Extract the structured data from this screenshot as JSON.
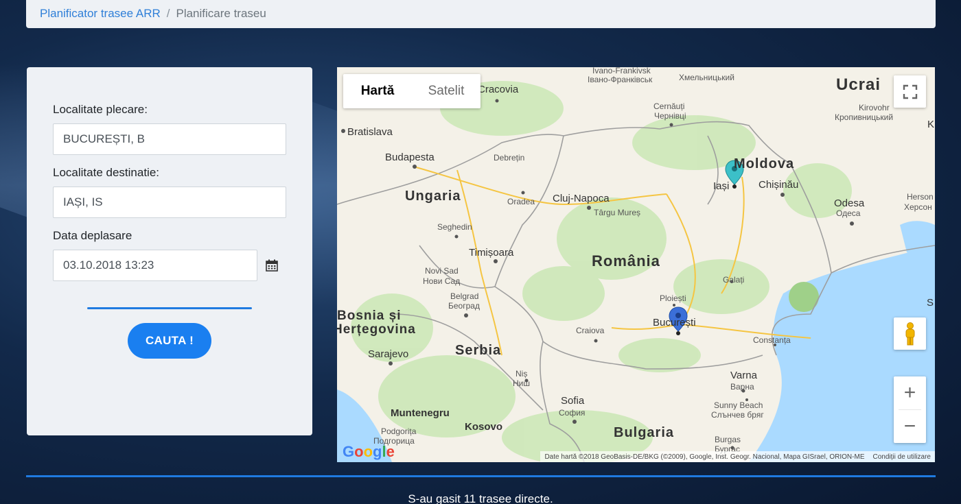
{
  "breadcrumb": {
    "parent": "Planificator trasee ARR",
    "separator": "/",
    "current": "Planificare traseu"
  },
  "form": {
    "departure_label": "Localitate plecare:",
    "departure_value": "BUCUREȘTI, B",
    "destination_label": "Localitate destinatie:",
    "destination_value": "IAȘI, IS",
    "date_label": "Data deplasare",
    "date_value": "03.10.2018 13:23",
    "calendar_icon": "calendar-icon",
    "search_button": "CAUTA !"
  },
  "map": {
    "tabs": {
      "map": "Hartă",
      "satellite": "Satelit"
    },
    "fullscreen_icon": "fullscreen-icon",
    "pegman_icon": "pegman-icon",
    "zoom_in": "+",
    "zoom_out": "−",
    "google_logo": "Google",
    "attribution": "Date hartă ©2018 GeoBasis-DE/BKG (©2009), Google, Inst. Geogr. Nacional, Mapa GISrael, ORION-ME",
    "terms": "Condiții de utilizare",
    "labels": {
      "ivano": "Ivano-Frankivsk",
      "ivano_cyr": "Івано-Франківськ",
      "khmel": "Хмельницький",
      "cracovia": "Cracovia",
      "ucraina": "Ucrai",
      "kirovohr": "Kirovohr",
      "kropyv": "Кропивницький",
      "cernauti": "Cernăuți",
      "cernauti_cyr": "Чернівці",
      "bratislava": "Bratislava",
      "budapesta": "Budapesta",
      "debretin": "Debrețin",
      "moldova": "Moldova",
      "iasi": "Iași",
      "chisinau": "Chișinău",
      "ungaria": "Ungaria",
      "oradea": "Oradea",
      "cluj": "Cluj-Napoca",
      "targu": "Târgu Mureș",
      "odesa": "Odesa",
      "odesa_cyr": "Одеса",
      "herson": "Herson",
      "herson_cyr": "Херсон",
      "seghedin": "Seghedin",
      "timisoara": "Timișoara",
      "romania": "România",
      "novisad": "Novi Sad",
      "novisad_cyr": "Нови Сад",
      "galati": "Galați",
      "belgrad": "Belgrad",
      "belgrad_cyr": "Београд",
      "ploiesti": "Ploiești",
      "bosnia1": "Bosnia și",
      "bosnia2": "Herțegovina",
      "bucuresti": "București",
      "craiova": "Craiova",
      "constanta": "Constanța",
      "sarajevo": "Sarajevo",
      "serbia": "Serbia",
      "nis": "Niș",
      "nis_cyr": "Ниш",
      "varna": "Varna",
      "varna_cyr": "Варна",
      "sofia": "Sofia",
      "sofia_cyr": "София",
      "sunny": "Sunny Beach",
      "sunny_cyr": "Слънчев бряг",
      "muntenegru": "Muntenegru",
      "kosovo": "Kosovo",
      "bulgaria": "Bulgaria",
      "podgorita": "Podgorița",
      "podgorita_cyr": "Подгорица",
      "burgas": "Burgas",
      "burgas_cyr": "Бургас",
      "s": "S",
      "k": "K"
    }
  },
  "results": {
    "summary": "S-au gasit 11 trasee directe."
  },
  "colors": {
    "accent": "#1a7ff0",
    "panel": "#eef1f5",
    "link": "#2f7fd8",
    "marker_origin": "#3b6fd8",
    "marker_destination": "#3cc0c8"
  }
}
